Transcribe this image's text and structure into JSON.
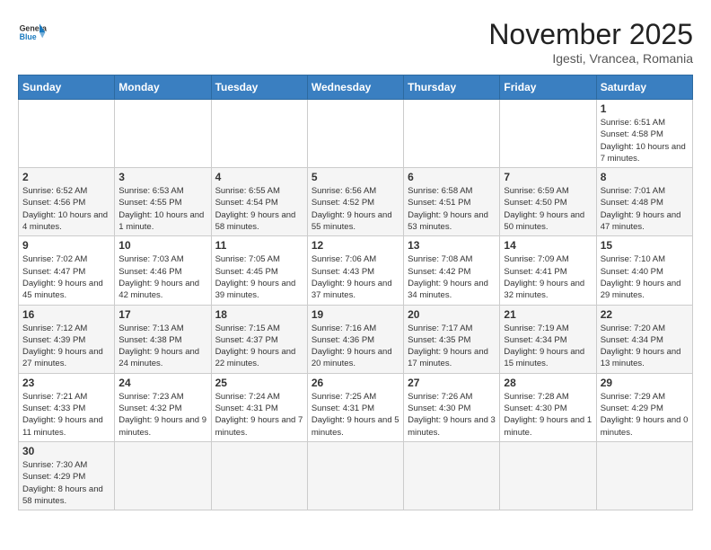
{
  "header": {
    "logo_general": "General",
    "logo_blue": "Blue",
    "month": "November 2025",
    "location": "Igesti, Vrancea, Romania"
  },
  "days_of_week": [
    "Sunday",
    "Monday",
    "Tuesday",
    "Wednesday",
    "Thursday",
    "Friday",
    "Saturday"
  ],
  "weeks": [
    [
      {
        "day": "",
        "info": ""
      },
      {
        "day": "",
        "info": ""
      },
      {
        "day": "",
        "info": ""
      },
      {
        "day": "",
        "info": ""
      },
      {
        "day": "",
        "info": ""
      },
      {
        "day": "",
        "info": ""
      },
      {
        "day": "1",
        "info": "Sunrise: 6:51 AM\nSunset: 4:58 PM\nDaylight: 10 hours and 7 minutes."
      }
    ],
    [
      {
        "day": "2",
        "info": "Sunrise: 6:52 AM\nSunset: 4:56 PM\nDaylight: 10 hours and 4 minutes."
      },
      {
        "day": "3",
        "info": "Sunrise: 6:53 AM\nSunset: 4:55 PM\nDaylight: 10 hours and 1 minute."
      },
      {
        "day": "4",
        "info": "Sunrise: 6:55 AM\nSunset: 4:54 PM\nDaylight: 9 hours and 58 minutes."
      },
      {
        "day": "5",
        "info": "Sunrise: 6:56 AM\nSunset: 4:52 PM\nDaylight: 9 hours and 55 minutes."
      },
      {
        "day": "6",
        "info": "Sunrise: 6:58 AM\nSunset: 4:51 PM\nDaylight: 9 hours and 53 minutes."
      },
      {
        "day": "7",
        "info": "Sunrise: 6:59 AM\nSunset: 4:50 PM\nDaylight: 9 hours and 50 minutes."
      },
      {
        "day": "8",
        "info": "Sunrise: 7:01 AM\nSunset: 4:48 PM\nDaylight: 9 hours and 47 minutes."
      }
    ],
    [
      {
        "day": "9",
        "info": "Sunrise: 7:02 AM\nSunset: 4:47 PM\nDaylight: 9 hours and 45 minutes."
      },
      {
        "day": "10",
        "info": "Sunrise: 7:03 AM\nSunset: 4:46 PM\nDaylight: 9 hours and 42 minutes."
      },
      {
        "day": "11",
        "info": "Sunrise: 7:05 AM\nSunset: 4:45 PM\nDaylight: 9 hours and 39 minutes."
      },
      {
        "day": "12",
        "info": "Sunrise: 7:06 AM\nSunset: 4:43 PM\nDaylight: 9 hours and 37 minutes."
      },
      {
        "day": "13",
        "info": "Sunrise: 7:08 AM\nSunset: 4:42 PM\nDaylight: 9 hours and 34 minutes."
      },
      {
        "day": "14",
        "info": "Sunrise: 7:09 AM\nSunset: 4:41 PM\nDaylight: 9 hours and 32 minutes."
      },
      {
        "day": "15",
        "info": "Sunrise: 7:10 AM\nSunset: 4:40 PM\nDaylight: 9 hours and 29 minutes."
      }
    ],
    [
      {
        "day": "16",
        "info": "Sunrise: 7:12 AM\nSunset: 4:39 PM\nDaylight: 9 hours and 27 minutes."
      },
      {
        "day": "17",
        "info": "Sunrise: 7:13 AM\nSunset: 4:38 PM\nDaylight: 9 hours and 24 minutes."
      },
      {
        "day": "18",
        "info": "Sunrise: 7:15 AM\nSunset: 4:37 PM\nDaylight: 9 hours and 22 minutes."
      },
      {
        "day": "19",
        "info": "Sunrise: 7:16 AM\nSunset: 4:36 PM\nDaylight: 9 hours and 20 minutes."
      },
      {
        "day": "20",
        "info": "Sunrise: 7:17 AM\nSunset: 4:35 PM\nDaylight: 9 hours and 17 minutes."
      },
      {
        "day": "21",
        "info": "Sunrise: 7:19 AM\nSunset: 4:34 PM\nDaylight: 9 hours and 15 minutes."
      },
      {
        "day": "22",
        "info": "Sunrise: 7:20 AM\nSunset: 4:34 PM\nDaylight: 9 hours and 13 minutes."
      }
    ],
    [
      {
        "day": "23",
        "info": "Sunrise: 7:21 AM\nSunset: 4:33 PM\nDaylight: 9 hours and 11 minutes."
      },
      {
        "day": "24",
        "info": "Sunrise: 7:23 AM\nSunset: 4:32 PM\nDaylight: 9 hours and 9 minutes."
      },
      {
        "day": "25",
        "info": "Sunrise: 7:24 AM\nSunset: 4:31 PM\nDaylight: 9 hours and 7 minutes."
      },
      {
        "day": "26",
        "info": "Sunrise: 7:25 AM\nSunset: 4:31 PM\nDaylight: 9 hours and 5 minutes."
      },
      {
        "day": "27",
        "info": "Sunrise: 7:26 AM\nSunset: 4:30 PM\nDaylight: 9 hours and 3 minutes."
      },
      {
        "day": "28",
        "info": "Sunrise: 7:28 AM\nSunset: 4:30 PM\nDaylight: 9 hours and 1 minute."
      },
      {
        "day": "29",
        "info": "Sunrise: 7:29 AM\nSunset: 4:29 PM\nDaylight: 9 hours and 0 minutes."
      }
    ],
    [
      {
        "day": "30",
        "info": "Sunrise: 7:30 AM\nSunset: 4:29 PM\nDaylight: 8 hours and 58 minutes."
      },
      {
        "day": "",
        "info": ""
      },
      {
        "day": "",
        "info": ""
      },
      {
        "day": "",
        "info": ""
      },
      {
        "day": "",
        "info": ""
      },
      {
        "day": "",
        "info": ""
      },
      {
        "day": "",
        "info": ""
      }
    ]
  ]
}
